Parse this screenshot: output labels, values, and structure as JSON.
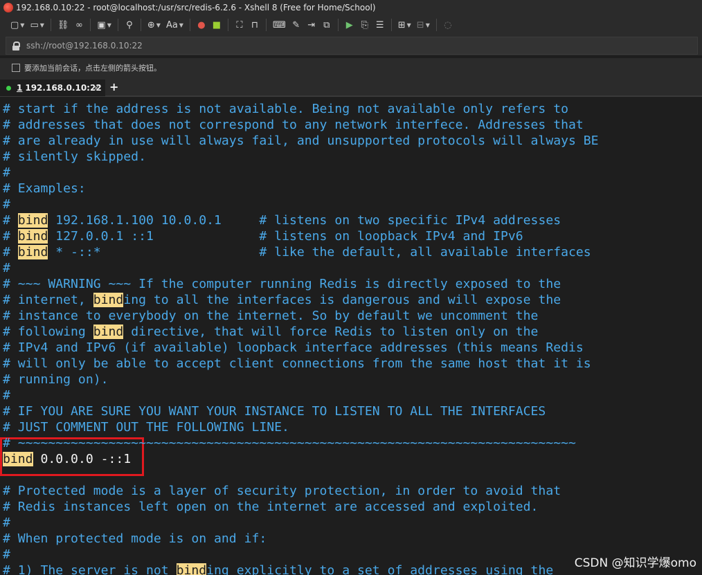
{
  "window": {
    "title": "192.168.0.10:22 - root@localhost:/usr/src/redis-6.2.6 - Xshell 8 (Free for Home/School)"
  },
  "toolbar": {
    "icons": [
      "new-session-icon",
      "open-folder-icon",
      "reconnect-icon",
      "link-icon",
      "new-tab-icon",
      "search-icon",
      "globe-icon",
      "font-icon",
      "xftp-icon",
      "xmanager-icon",
      "fullscreen-icon",
      "lock-icon",
      "keyboard-icon",
      "script-icon",
      "send-icon",
      "compose-icon",
      "start-log-icon",
      "copy-icon",
      "notes-icon",
      "add-pane-icon",
      "layout-icon",
      "help-icon"
    ],
    "font_label": "Aa"
  },
  "address": {
    "value": "ssh://root@192.168.0.10:22"
  },
  "hint": {
    "text": "要添加当前会话，点击左侧的箭头按钮。"
  },
  "tabs": [
    {
      "number": "1",
      "label": "192.168.0.10:22",
      "close": "×",
      "status_color": "#3ecf4a"
    }
  ],
  "add_tab_label": "+",
  "terminal": {
    "lines": [
      {
        "segments": [
          {
            "text": "# start if the address is not available. Being not available only refers to"
          }
        ]
      },
      {
        "segments": [
          {
            "text": "# addresses that does not correspond to any network interfece. Addresses that"
          }
        ]
      },
      {
        "segments": [
          {
            "text": "# are already in use will always fail, and unsupported protocols will always BE"
          }
        ]
      },
      {
        "segments": [
          {
            "text": "# silently skipped."
          }
        ]
      },
      {
        "segments": [
          {
            "text": "#"
          }
        ]
      },
      {
        "segments": [
          {
            "text": "# Examples:"
          }
        ]
      },
      {
        "segments": [
          {
            "text": "#"
          }
        ]
      },
      {
        "segments": [
          {
            "text": "# "
          },
          {
            "text": "bind",
            "hl": true
          },
          {
            "text": " 192.168.1.100 10.0.0.1     # listens on two specific IPv4 addresses"
          }
        ]
      },
      {
        "segments": [
          {
            "text": "# "
          },
          {
            "text": "bind",
            "hl": true
          },
          {
            "text": " 127.0.0.1 ::1              # listens on loopback IPv4 and IPv6"
          }
        ]
      },
      {
        "segments": [
          {
            "text": "# "
          },
          {
            "text": "bind",
            "hl": true
          },
          {
            "text": " * -::*                     # like the default, all available interfaces"
          }
        ]
      },
      {
        "segments": [
          {
            "text": "#"
          }
        ]
      },
      {
        "segments": [
          {
            "text": "# ~~~ WARNING ~~~ If the computer running Redis is directly exposed to the"
          }
        ]
      },
      {
        "segments": [
          {
            "text": "# internet, "
          },
          {
            "text": "bind",
            "hl": true
          },
          {
            "text": "ing to all the interfaces is dangerous and will expose the"
          }
        ]
      },
      {
        "segments": [
          {
            "text": "# instance to everybody on the internet. So by default we uncomment the"
          }
        ]
      },
      {
        "segments": [
          {
            "text": "# following "
          },
          {
            "text": "bind",
            "hl": true
          },
          {
            "text": " directive, that will force Redis to listen only on the"
          }
        ]
      },
      {
        "segments": [
          {
            "text": "# IPv4 and IPv6 (if available) loopback interface addresses (this means Redis"
          }
        ]
      },
      {
        "segments": [
          {
            "text": "# will only be able to accept client connections from the same host that it is"
          }
        ]
      },
      {
        "segments": [
          {
            "text": "# running on)."
          }
        ]
      },
      {
        "segments": [
          {
            "text": "#"
          }
        ]
      },
      {
        "segments": [
          {
            "text": "# IF YOU ARE SURE YOU WANT YOUR INSTANCE TO LISTEN TO ALL THE INTERFACES"
          }
        ]
      },
      {
        "segments": [
          {
            "text": "# JUST COMMENT OUT THE FOLLOWING LINE."
          }
        ]
      },
      {
        "segments": [
          {
            "text": "# ~~~~~~~~~~~~~~~~~~~~~~~~~~~~~~~~~~~~~~~~~~~~~~~~~~~~~~~~~~~~~~~~~~~~~~~~~~"
          }
        ]
      },
      {
        "cmd": true,
        "segments": [
          {
            "text": "bind",
            "hl": true
          },
          {
            "text": " 0.0.0.0 -::1"
          }
        ]
      },
      {
        "segments": [
          {
            "text": ""
          }
        ]
      },
      {
        "segments": [
          {
            "text": "# Protected mode is a layer of security protection, in order to avoid that"
          }
        ]
      },
      {
        "segments": [
          {
            "text": "# Redis instances left open on the internet are accessed and exploited."
          }
        ]
      },
      {
        "segments": [
          {
            "text": "#"
          }
        ]
      },
      {
        "segments": [
          {
            "text": "# When protected mode is on and if:"
          }
        ]
      },
      {
        "segments": [
          {
            "text": "#"
          }
        ]
      },
      {
        "segments": [
          {
            "text": "# 1) The server is not "
          },
          {
            "text": "bind",
            "hl": true
          },
          {
            "text": "ing explicitly to a set of addresses using the"
          }
        ]
      }
    ]
  },
  "watermark": "CSDN @知识学爆omo",
  "colors": {
    "comment": "#4aa8e8",
    "highlight": "#f7d98a",
    "selection_box": "#e0191f",
    "background": "#1e1e1e"
  }
}
